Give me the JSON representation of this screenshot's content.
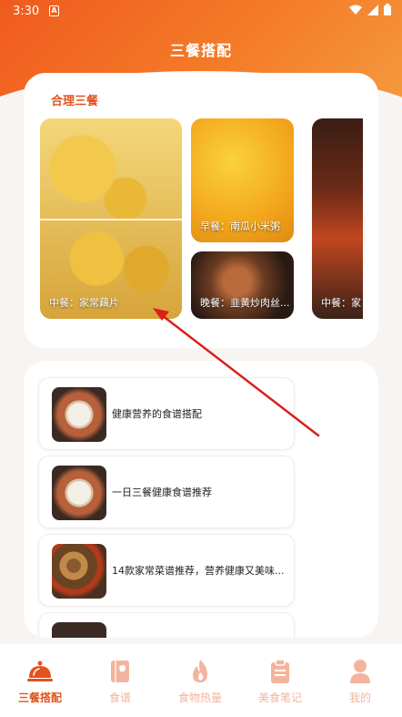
{
  "status_bar": {
    "time": "3:30",
    "notification_icon": "A"
  },
  "header": {
    "title": "三餐搭配"
  },
  "meals_section": {
    "title": "合理三餐",
    "tiles": [
      {
        "caption": "中餐：家常藕片"
      },
      {
        "caption": "早餐：南瓜小米粥"
      },
      {
        "caption": "晚餐：韭黄炒肉丝..."
      },
      {
        "caption": "中餐：家"
      }
    ]
  },
  "recipe_list": {
    "items": [
      {
        "label": "健康营养的食谱搭配"
      },
      {
        "label": "一日三餐健康食谱推荐"
      },
      {
        "label": "14款家常菜谱推荐，营养健康又美味..."
      },
      {
        "label": ""
      }
    ]
  },
  "tabbar": {
    "tabs": [
      {
        "label": "三餐搭配",
        "icon": "cloche-icon",
        "active": true
      },
      {
        "label": "食谱",
        "icon": "book-icon",
        "active": false
      },
      {
        "label": "食物热量",
        "icon": "flame-icon",
        "active": false
      },
      {
        "label": "美食笔记",
        "icon": "clipboard-icon",
        "active": false
      },
      {
        "label": "我的",
        "icon": "person-icon",
        "active": false
      }
    ]
  },
  "colors": {
    "accent": "#e2531f",
    "inactive": "#f2b49c",
    "header_gradient_start": "#f05a1e",
    "header_gradient_end": "#f59a3f",
    "annotation_arrow": "#d9201c"
  }
}
